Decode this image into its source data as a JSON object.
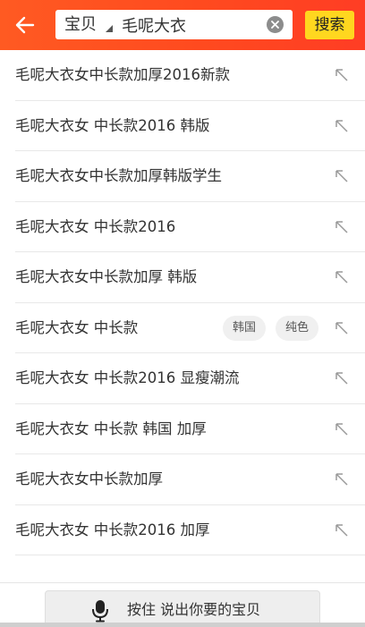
{
  "header": {
    "scope_label": "宝贝",
    "search_value": "毛呢大衣",
    "search_button_label": "搜索",
    "icons": {
      "back": "arrow-left-icon",
      "clear": "close-circle-icon",
      "scope": "caret-icon"
    },
    "colors": {
      "bar": "#ff4a1f",
      "search_button": "#ffd71f"
    }
  },
  "suggestions": [
    {
      "text": "毛呢大衣女中长款加厚2016新款"
    },
    {
      "text": "毛呢大衣女 中长款2016 韩版"
    },
    {
      "text": "毛呢大衣女中长款加厚韩版学生"
    },
    {
      "text": "毛呢大衣女 中长款2016"
    },
    {
      "text": "毛呢大衣女中长款加厚 韩版"
    },
    {
      "text": "毛呢大衣女 中长款",
      "tags": [
        "韩国",
        "纯色"
      ]
    },
    {
      "text": "毛呢大衣女 中长款2016 显瘦潮流"
    },
    {
      "text": "毛呢大衣女 中长款 韩国 加厚"
    },
    {
      "text": "毛呢大衣女中长款加厚"
    },
    {
      "text": "毛呢大衣女 中长款2016 加厚"
    }
  ],
  "voice": {
    "label": "按住 说出你要的宝贝",
    "icon": "microphone-icon"
  }
}
